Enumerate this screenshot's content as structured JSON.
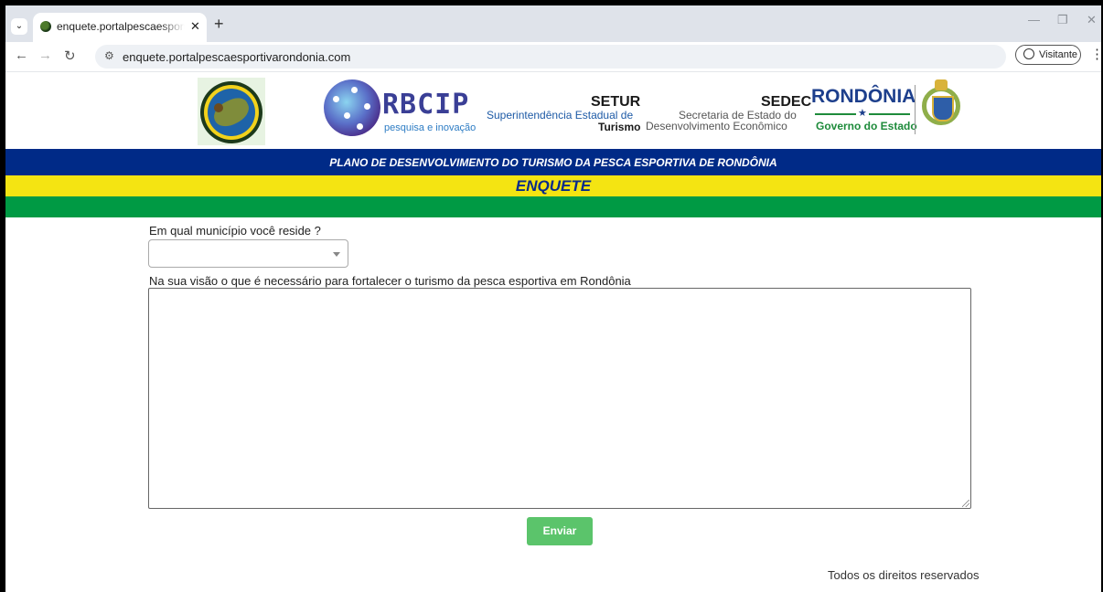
{
  "browser": {
    "tab_title": "enquete.portalpescaesportivarondonia.com",
    "tab_close": "✕",
    "new_tab": "+",
    "url": "enquete.portalpescaesportivarondonia.com",
    "profile_label": "Visitante",
    "icons": [
      "tab-list-icon",
      "favicon-icon",
      "back-icon",
      "forward-icon",
      "reload-icon",
      "site-info-icon",
      "profile-icon",
      "menu-icon",
      "minimize-icon",
      "restore-icon",
      "close-icon"
    ]
  },
  "header": {
    "rbcip": {
      "name": "RBCIP",
      "tagline": "pesquisa e inovação"
    },
    "setur": {
      "title": "SETUR",
      "line1": "Superintendência Estadual de",
      "line2": "Turismo"
    },
    "sedec": {
      "title": "SEDEC",
      "line1": "Secretaria de Estado do",
      "line2": "Desenvolvimento Econômico"
    },
    "rondonia": {
      "title": "RONDÔNIA",
      "star": "★",
      "subtitle": "Governo do Estado"
    }
  },
  "banner": {
    "plan_title": "PLANO DE DESENVOLVIMENTO DO TURISMO DA PESCA ESPORTIVA DE RONDÔNIA",
    "section_title": "ENQUETE",
    "colors": {
      "blue": "#002a87",
      "yellow": "#f4e412",
      "green": "#009a44"
    }
  },
  "form": {
    "question_municipio": "Em qual município você reside ?",
    "municipio_value": "",
    "question_turismo": "Na sua visão o que é necessário para fortalecer o turismo da pesca esportiva em Rondônia",
    "turismo_value": "",
    "submit_label": "Enviar",
    "submit_color": "#5bc46b"
  },
  "footer": {
    "text": "Todos os direitos reservados"
  }
}
